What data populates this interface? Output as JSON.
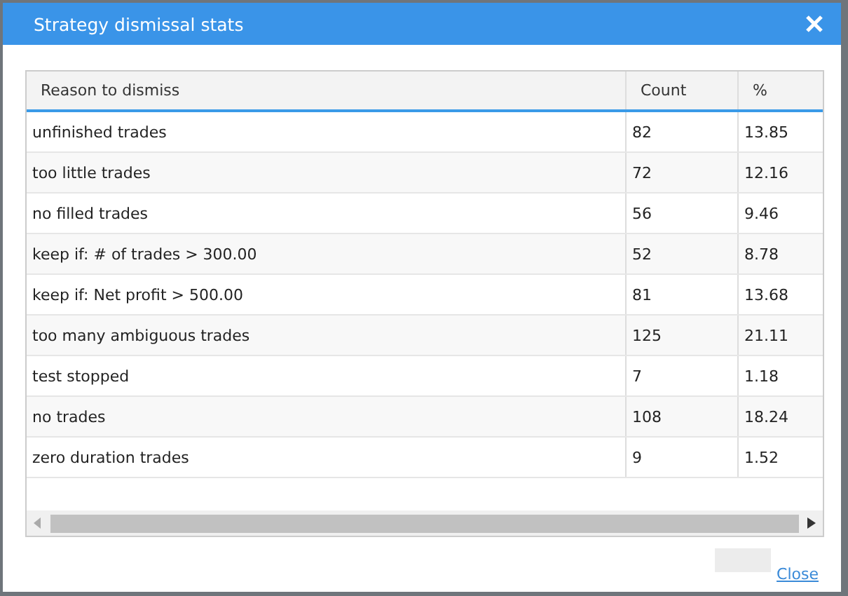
{
  "dialog": {
    "title": "Strategy dismissal stats"
  },
  "table": {
    "columns": [
      "Reason to dismiss",
      "Count",
      "%"
    ],
    "rows": [
      {
        "cells": [
          "unfinished trades",
          "82",
          "13.85"
        ]
      },
      {
        "cells": [
          "too little trades",
          "72",
          "12.16"
        ]
      },
      {
        "cells": [
          "no filled trades",
          "56",
          "9.46"
        ]
      },
      {
        "cells": [
          "keep if: # of trades > 300.00",
          "52",
          "8.78"
        ]
      },
      {
        "cells": [
          "keep if: Net profit > 500.00",
          "81",
          "13.68"
        ]
      },
      {
        "cells": [
          "too many ambiguous trades",
          "125",
          "21.11"
        ]
      },
      {
        "cells": [
          "test stopped",
          "7",
          "1.18"
        ]
      },
      {
        "cells": [
          "no trades",
          "108",
          "18.24"
        ]
      },
      {
        "cells": [
          "zero duration trades",
          "9",
          "1.52"
        ]
      }
    ]
  },
  "footer": {
    "link": "Close"
  }
}
